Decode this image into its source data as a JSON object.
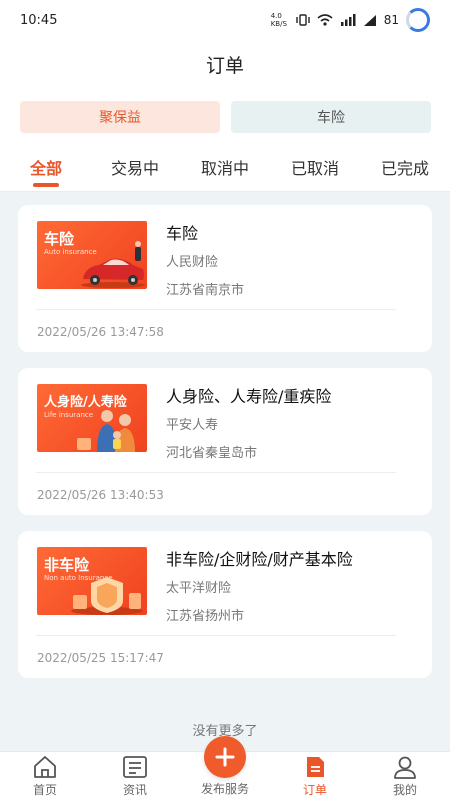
{
  "status_bar": {
    "time": "10:45",
    "network_speed": "4.0 KB/S",
    "battery": "81"
  },
  "nav": {
    "title": "订单"
  },
  "category_segments": [
    {
      "label": "聚保益",
      "selected": true
    },
    {
      "label": "车险",
      "selected": false
    }
  ],
  "filter_tabs": [
    {
      "label": "全部",
      "active": true
    },
    {
      "label": "交易中",
      "active": false
    },
    {
      "label": "取消中",
      "active": false
    },
    {
      "label": "已取消",
      "active": false
    },
    {
      "label": "已完成",
      "active": false
    }
  ],
  "orders": [
    {
      "title": "车险",
      "company": "人民财险",
      "location": "江苏省南京市",
      "time": "2022/05/26 13:47:58",
      "thumb_title": "车险",
      "thumb_sub": "Auto insurance"
    },
    {
      "title": "人身险、人寿险/重疾险",
      "company": "平安人寿",
      "location": "河北省秦皇岛市",
      "time": "2022/05/26 13:40:53",
      "thumb_title": "人身险/人寿险",
      "thumb_sub": "Life insurance"
    },
    {
      "title": "非车险/企财险/财产基本险",
      "company": "太平洋财险",
      "location": "江苏省扬州市",
      "time": "2022/05/25 15:17:47",
      "thumb_title": "非车险",
      "thumb_sub": "Non auto Insurance"
    }
  ],
  "list_footer": "没有更多了",
  "bottom_tabs": [
    {
      "label": "首页",
      "icon": "home-icon"
    },
    {
      "label": "资讯",
      "icon": "news-icon"
    },
    {
      "label": "发布服务",
      "icon": "plus-icon"
    },
    {
      "label": "订单",
      "icon": "order-icon",
      "active": true
    },
    {
      "label": "我的",
      "icon": "user-icon"
    }
  ],
  "colors": {
    "accent": "#e8562a",
    "background": "#eef3f5"
  }
}
